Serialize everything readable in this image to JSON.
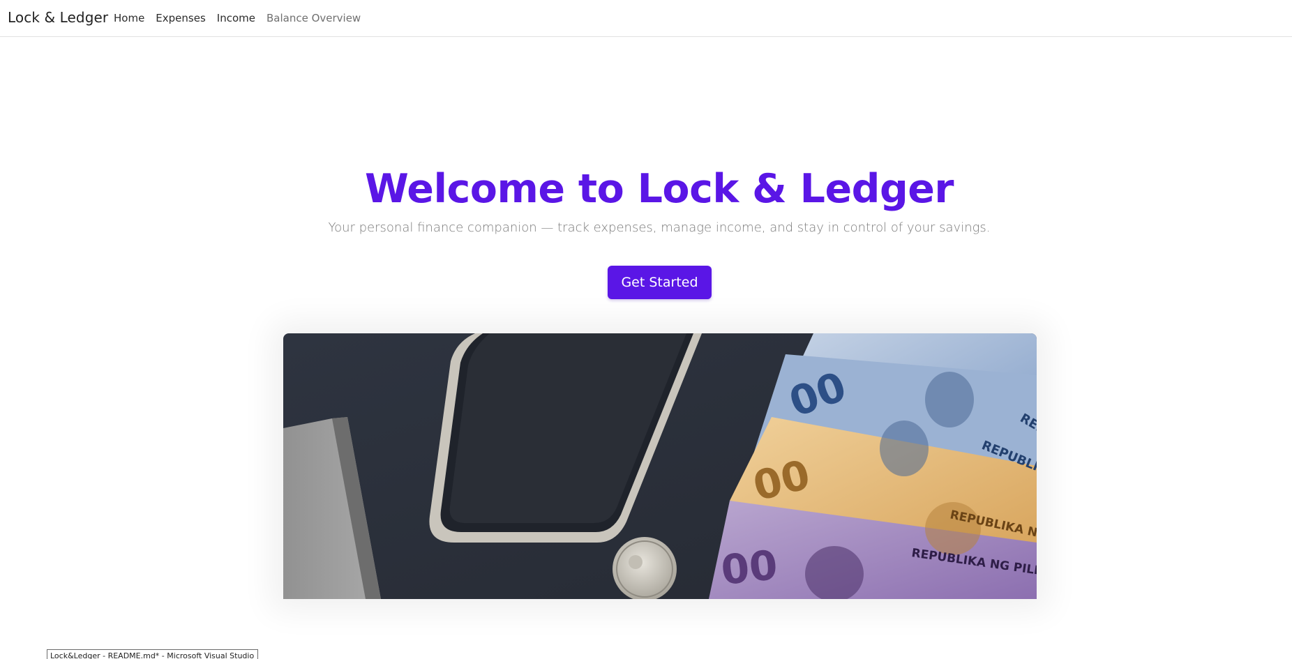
{
  "app": {
    "brand": "Lock & Ledger"
  },
  "nav": {
    "items": [
      {
        "label": "Home"
      },
      {
        "label": "Expenses"
      },
      {
        "label": "Income"
      },
      {
        "label": "Balance Overview"
      }
    ]
  },
  "hero": {
    "title": "Welcome to Lock & Ledger",
    "subtitle": "Your personal finance companion — track expenses, manage income, and stay in control of your savings.",
    "cta_label": "Get Started",
    "image_banknote_text": [
      "REPUBLIKA",
      "REPUBLIKA NG P",
      "REPUBLIKA NG PILIPIN",
      "REP"
    ]
  },
  "system": {
    "tooltip_text": "Lock&Ledger - README.md* - Microsoft Visual Studio"
  },
  "colors": {
    "accent": "#5a16e6",
    "subtitle": "#7a7a7a",
    "nav_text": "#2b2b2b",
    "nav_muted": "#6f6f6f"
  }
}
